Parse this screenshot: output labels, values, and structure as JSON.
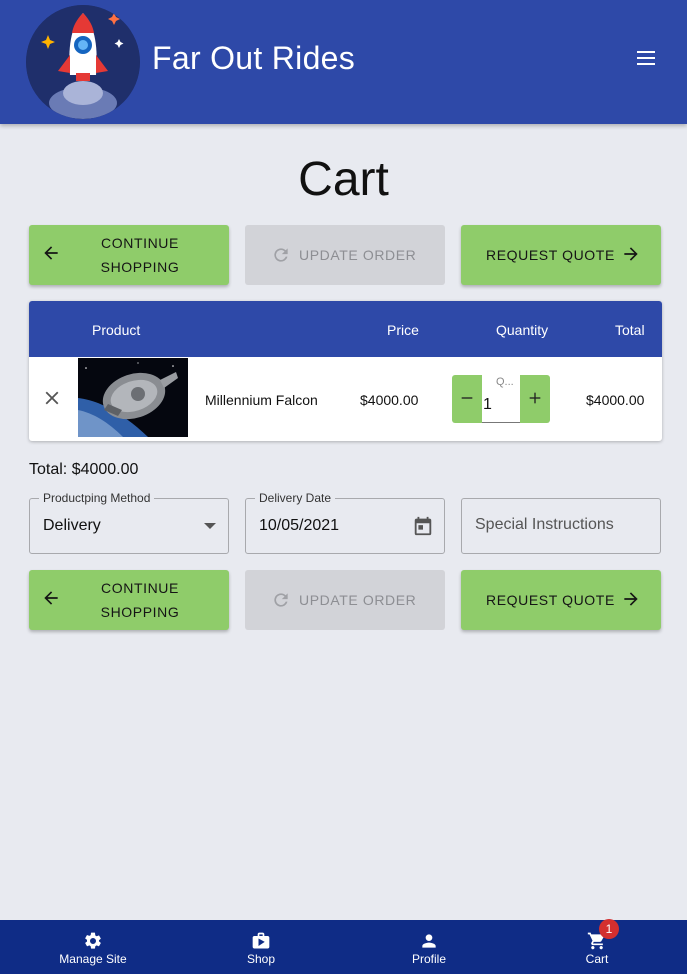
{
  "header": {
    "brand": "Far Out Rides",
    "logo_icon": "rocket-logo",
    "menu_icon": "hamburger-menu-icon"
  },
  "page": {
    "title": "Cart"
  },
  "actions": {
    "continue_shopping": "CONTINUE SHOPPING",
    "update_order": "UPDATE ORDER",
    "request_quote": "REQUEST QUOTE"
  },
  "table": {
    "headers": {
      "product": "Product",
      "price": "Price",
      "quantity": "Quantity",
      "total": "Total"
    },
    "rows": [
      {
        "product": "Millennium Falcon",
        "price": "$4000.00",
        "quantity_label": "Q...",
        "quantity": "1",
        "total": "$4000.00"
      }
    ]
  },
  "summary": {
    "total": "Total: $4000.00"
  },
  "form": {
    "shipping_method": {
      "label": "Productping Method",
      "value": "Delivery"
    },
    "delivery_date": {
      "label": "Delivery Date",
      "value": "10/05/2021"
    },
    "special_instructions": {
      "placeholder": "Special Instructions"
    }
  },
  "bottom_nav": {
    "items": [
      {
        "label": "Manage Site",
        "icon": "gear-icon"
      },
      {
        "label": "Shop",
        "icon": "shopping-bag-icon"
      },
      {
        "label": "Profile",
        "icon": "person-icon"
      },
      {
        "label": "Cart",
        "icon": "cart-icon"
      }
    ],
    "cart_badge": "1"
  },
  "colors": {
    "header": "#2e49a8",
    "accent_green": "#8fcc6a",
    "background": "#e8eaf0",
    "bottom_nav": "#0f2c86",
    "badge": "#d32f2f"
  }
}
